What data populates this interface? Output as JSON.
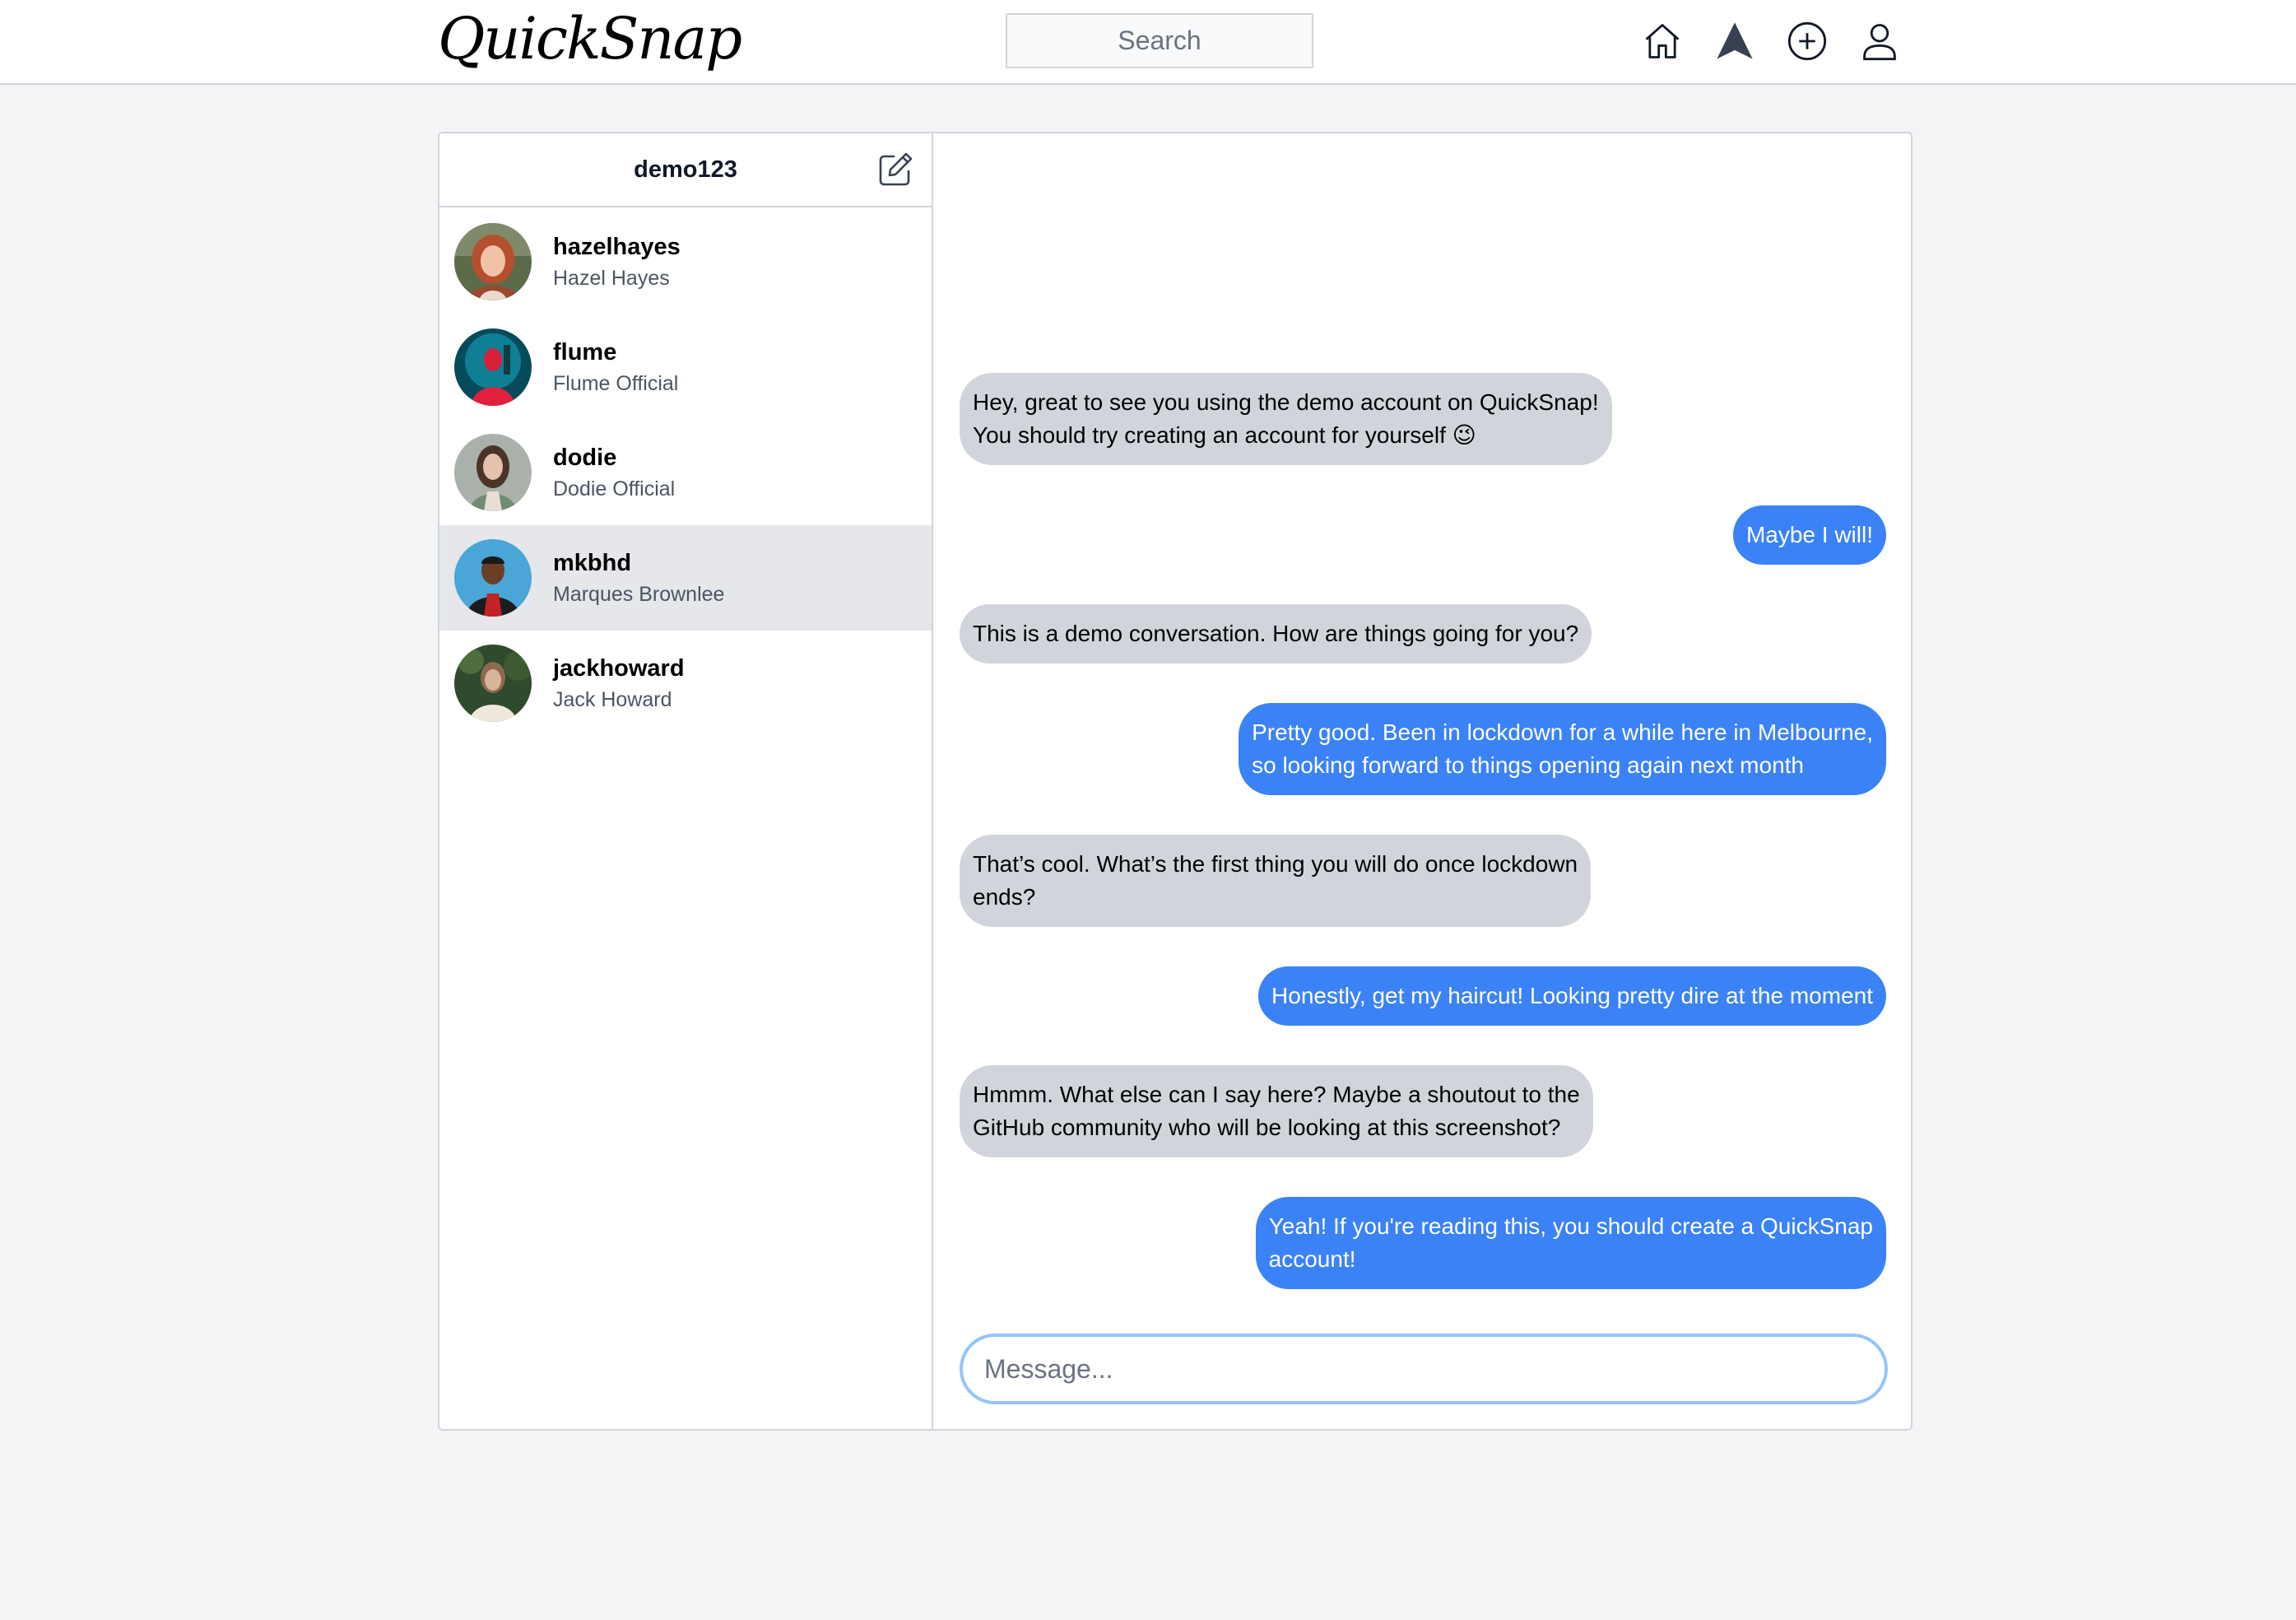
{
  "app": {
    "logo": "QuickSnap",
    "search_placeholder": "Search",
    "nav": [
      "home-icon",
      "direct-messages-icon",
      "new-post-icon",
      "profile-icon"
    ]
  },
  "sidebar": {
    "username": "demo123",
    "conversations": [
      {
        "username": "hazelhayes",
        "fullname": "Hazel Hayes",
        "active": false
      },
      {
        "username": "flume",
        "fullname": "Flume Official",
        "active": false
      },
      {
        "username": "dodie",
        "fullname": "Dodie Official",
        "active": false
      },
      {
        "username": "mkbhd",
        "fullname": "Marques Brownlee",
        "active": true
      },
      {
        "username": "jackhoward",
        "fullname": "Jack Howard",
        "active": false
      }
    ]
  },
  "chat": {
    "messages": [
      {
        "direction": "in",
        "lines": [
          "Hey, great to see you using the demo account on QuickSnap!",
          "You should try creating an account for yourself 😉"
        ]
      },
      {
        "direction": "out",
        "lines": [
          "Maybe I will!"
        ]
      },
      {
        "direction": "in",
        "lines": [
          "This is a demo conversation. How are things going for you?"
        ]
      },
      {
        "direction": "out",
        "lines": [
          "Pretty good. Been in lockdown for a while here in Melbourne,",
          "so looking forward to things opening again next month"
        ]
      },
      {
        "direction": "in",
        "lines": [
          "That’s cool. What’s the first thing you will do once lockdown",
          "ends?"
        ]
      },
      {
        "direction": "out",
        "lines": [
          "Honestly, get my haircut! Looking pretty dire at the moment"
        ]
      },
      {
        "direction": "in",
        "lines": [
          "Hmmm. What else can I say here? Maybe a shoutout to the",
          "GitHub community who will be looking at this screenshot?"
        ]
      },
      {
        "direction": "out",
        "lines": [
          "Yeah! If you're reading this, you should create a QuickSnap",
          "account!"
        ]
      }
    ],
    "input_placeholder": "Message..."
  },
  "colors": {
    "outgoing_bubble": "#3b82f6",
    "incoming_bubble": "#d1d5db",
    "input_focus_ring": "#93c5fd",
    "active_row": "#e5e7eb"
  }
}
